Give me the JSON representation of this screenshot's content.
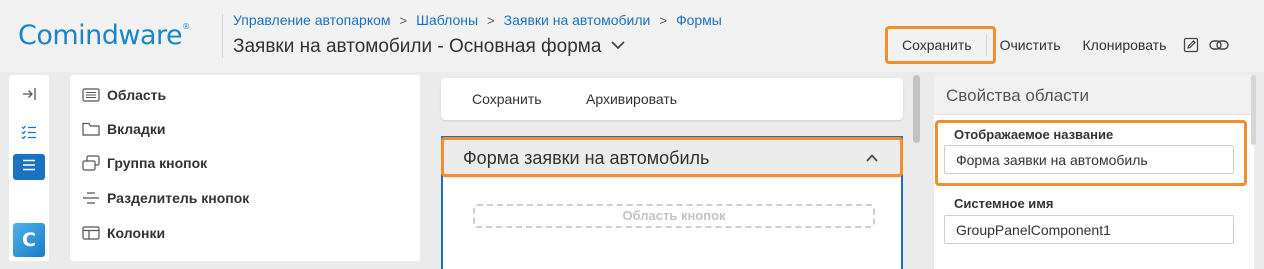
{
  "app": {
    "logo_text": "Comindware",
    "logo_mark": "®",
    "brand_color": "#1a86c9",
    "accent_color": "#1a73c0",
    "highlight_color": "#f28e2b"
  },
  "breadcrumb": {
    "items": [
      "Управление автопарком",
      "Шаблоны",
      "Заявки на автомобили",
      "Формы"
    ],
    "separator": ">"
  },
  "page": {
    "title": "Заявки на автомобили - Основная форма",
    "title_chevron": "chevron-down-icon"
  },
  "toolbar": {
    "save_label": "Сохранить",
    "clear_label": "Очистить",
    "clone_label": "Клонировать",
    "edit_icon": "edit-icon",
    "link_icon": "link-icon"
  },
  "rail": {
    "items": [
      {
        "icon": "collapse-panel-icon"
      },
      {
        "icon": "checklist-icon"
      },
      {
        "icon": "list-icon",
        "active": true
      }
    ],
    "app_badge": "C"
  },
  "components": {
    "items": [
      {
        "icon": "area-icon",
        "label": "Область"
      },
      {
        "icon": "tabs-icon",
        "label": "Вкладки"
      },
      {
        "icon": "button-group-icon",
        "label": "Группа кнопок"
      },
      {
        "icon": "button-separator-icon",
        "label": "Разделитель кнопок"
      },
      {
        "icon": "columns-icon",
        "label": "Колонки"
      }
    ]
  },
  "canvas": {
    "buttons": [
      "Сохранить",
      "Архивировать"
    ],
    "form_title": "Форма заявки на автомобиль",
    "collapse_icon": "chevron-up-icon",
    "button_area_placeholder": "Область кнопок"
  },
  "properties": {
    "title": "Свойства области",
    "display_name_label": "Отображаемое название",
    "display_name_value": "Форма заявки на автомобиль",
    "system_name_label": "Системное имя",
    "system_name_value": "GroupPanelComponent1"
  }
}
